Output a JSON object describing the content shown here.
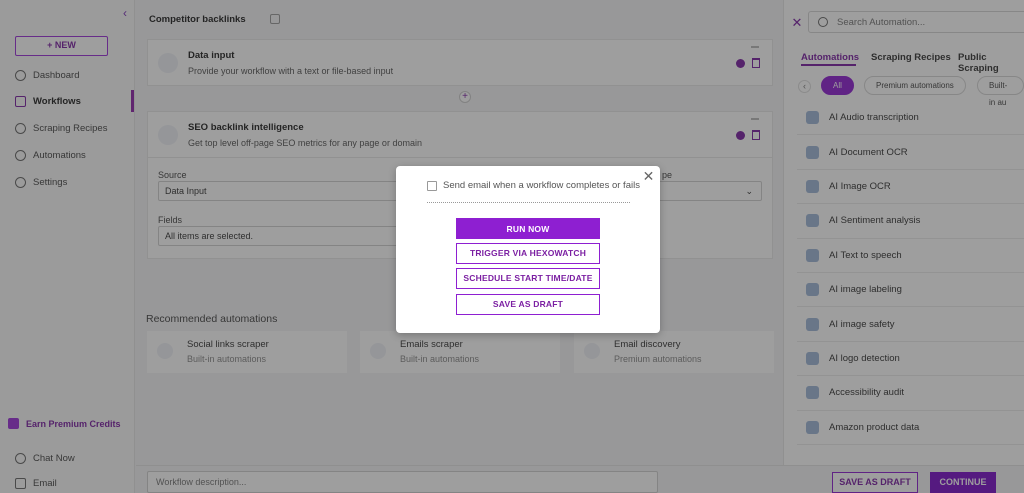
{
  "sidebar": {
    "new_label": "NEW",
    "nav": [
      {
        "label": "Dashboard",
        "icon": "dashboard-icon"
      },
      {
        "label": "Workflows",
        "icon": "workflows-icon",
        "active": true
      },
      {
        "label": "Scraping Recipes",
        "icon": "recipes-icon"
      },
      {
        "label": "Automations",
        "icon": "automations-icon"
      },
      {
        "label": "Settings",
        "icon": "gear-icon"
      }
    ],
    "premium_label": "Earn Premium Credits",
    "chat_label": "Chat Now",
    "email_label": "Email"
  },
  "workflow": {
    "title": "Competitor backlinks",
    "steps": [
      {
        "title": "Data input",
        "desc": "Provide your workflow with a text or file-based input"
      },
      {
        "title": "SEO backlink intelligence",
        "desc": "Get top level off-page SEO metrics for any page or domain"
      }
    ],
    "form": {
      "source_label": "Source",
      "source_value": "Data Input",
      "type_label_fragment": "pe",
      "fields_label": "Fields",
      "fields_value": "All items are selected."
    },
    "recommended_title": "Recommended automations",
    "recommended": [
      {
        "name": "Social links scraper",
        "sub": "Built-in automations"
      },
      {
        "name": "Emails scraper",
        "sub": "Built-in automations"
      },
      {
        "name": "Email discovery",
        "sub": "Premium automations"
      }
    ],
    "description_placeholder": "Workflow description..."
  },
  "right_panel": {
    "search_placeholder": "Search Automation...",
    "tabs": [
      "Automations",
      "Scraping Recipes",
      "Public Scraping"
    ],
    "chips": [
      "All",
      "Premium automations",
      "Built-in au"
    ],
    "automations": [
      "AI Audio transcription",
      "AI Document OCR",
      "AI Image OCR",
      "AI Sentiment analysis",
      "AI Text to speech",
      "AI image labeling",
      "AI image safety",
      "AI logo detection",
      "Accessibility audit",
      "Amazon product data"
    ]
  },
  "footer": {
    "save_draft_label": "SAVE AS DRAFT",
    "continue_label": "CONTINUE"
  },
  "modal": {
    "email_checkbox_label": "Send email when a workflow completes or fails",
    "email_checked": false,
    "buttons": [
      "RUN NOW",
      "TRIGGER VIA HEXOWATCH",
      "SCHEDULE START TIME/DATE",
      "SAVE AS DRAFT"
    ]
  },
  "colors": {
    "accent": "#8e1fd1",
    "accent_dark": "#7b1fa2"
  }
}
